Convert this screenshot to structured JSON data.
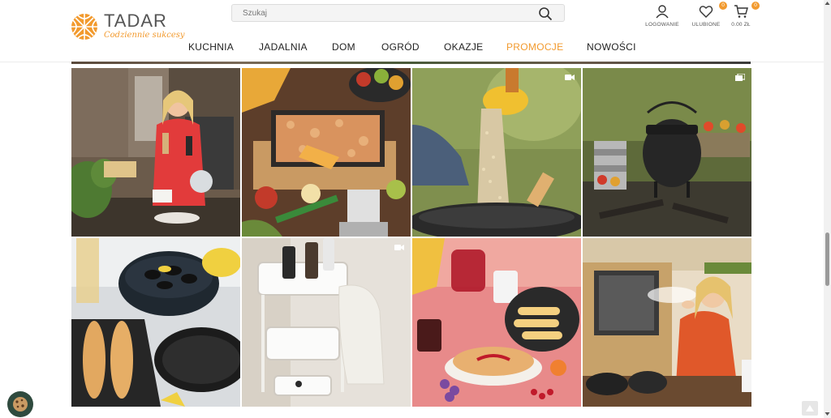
{
  "brand": {
    "name": "TADAR",
    "tagline": "Codziennie sukcesy",
    "accent": "#f29a2e"
  },
  "search": {
    "placeholder": "Szukaj",
    "value": ""
  },
  "header_actions": {
    "login_label": "LOGOWANIE",
    "favorites_label": "ULUBIONE",
    "favorites_count": "0",
    "cart_label": "0.00 ZŁ",
    "cart_count": "0"
  },
  "nav": {
    "items": [
      {
        "label": "KUCHNIA"
      },
      {
        "label": "JADALNIA"
      },
      {
        "label": "DOM"
      },
      {
        "label": "OGRÓD"
      },
      {
        "label": "OKAZJE"
      },
      {
        "label": "PROMOCJE",
        "highlighted": true
      },
      {
        "label": "NOWOŚCI"
      }
    ]
  },
  "gallery": {
    "tiles": [
      {
        "subject": "woman-in-red-kitchen",
        "badge": "none"
      },
      {
        "subject": "baking-apple-crumble",
        "badge": "none"
      },
      {
        "subject": "pouring-rice-into-wok",
        "badge": "video-icon"
      },
      {
        "subject": "cast-iron-pot-campfire",
        "badge": "gallery-icon"
      },
      {
        "subject": "mussels-and-bread",
        "badge": "none"
      },
      {
        "subject": "bathroom-trolley",
        "badge": "video-icon"
      },
      {
        "subject": "pancakes-with-jam",
        "badge": "none"
      },
      {
        "subject": "woman-blowing-flour",
        "badge": "none"
      }
    ]
  }
}
